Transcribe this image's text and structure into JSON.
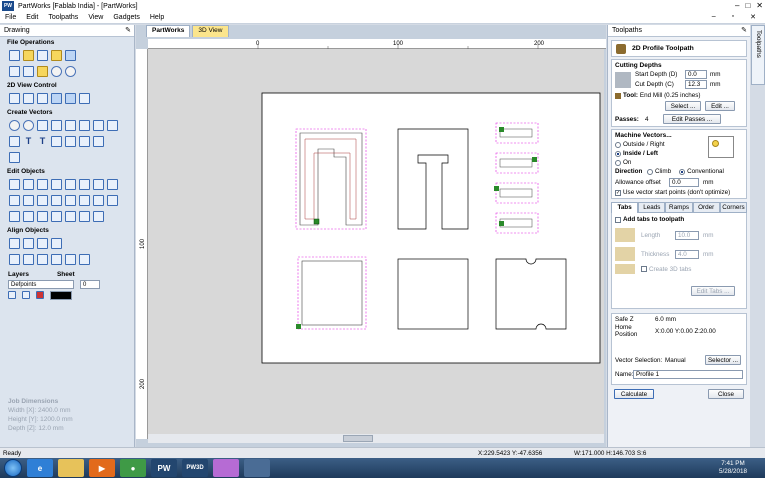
{
  "window": {
    "logo": "PW",
    "title": "PartWorks [Fablab India] - [PartWorks]",
    "controls": [
      "–",
      "□",
      "✕"
    ]
  },
  "menu": {
    "items": [
      "File",
      "Edit",
      "Toolpaths",
      "View",
      "Gadgets",
      "Help"
    ],
    "mdi_controls": [
      "–",
      "▫",
      "✕"
    ]
  },
  "drawing_panel": {
    "title": "Drawing",
    "sections": {
      "file_operations": "File Operations",
      "view_control": "2D View Control",
      "create_vectors": "Create Vectors",
      "edit_objects": "Edit Objects",
      "align_objects": "Align Objects"
    },
    "layers_label": "Layers",
    "sheet_label": "Sheet",
    "layer_value": "Defpoints",
    "sheet_value": "0",
    "job_dimensions": {
      "heading": "Job Dimensions",
      "width": "Width  [X]: 2400.0 mm",
      "height": "Height [Y]: 1200.0 mm",
      "depth": "Depth  [Z]: 12.0 mm"
    }
  },
  "view_tabs": {
    "tab1": "PartWorks",
    "tab2": "3D View"
  },
  "ruler": {
    "h_labels": [
      "0",
      "100",
      "200"
    ],
    "v_labels": [
      "100",
      "200"
    ]
  },
  "toolpaths_panel": {
    "title": "Toolpaths",
    "header": "2D Profile Toolpath",
    "cutting_depths": "Cutting Depths",
    "start_depth_label": "Start Depth (D)",
    "start_depth": "0.0",
    "cut_depth_label": "Cut Depth (C)",
    "cut_depth": "12.3",
    "unit": "mm",
    "tool_label": "Tool:",
    "tool_value": "End Mill (0.25 inches)",
    "select_btn": "Select ...",
    "edit_btn": "Edit ...",
    "passes_label": "Passes:",
    "passes_value": "4",
    "edit_passes_btn": "Edit Passes ...",
    "machine_vectors": "Machine Vectors...",
    "outside_right": "Outside / Right",
    "inside_left": "Inside / Left",
    "on": "On",
    "direction_label": "Direction",
    "climb": "Climb",
    "conventional": "Conventional",
    "allowance_label": "Allowance offset",
    "allowance_value": "0.0",
    "use_start_points": "Use vector start points (don't optimize)",
    "subtabs": [
      "Tabs",
      "Leads",
      "Ramps",
      "Order",
      "Corners"
    ],
    "add_tabs": "Add tabs to toolpath",
    "length_label": "Length",
    "length_value": "10.0",
    "thickness_label": "Thickness",
    "thickness_value": "4.0",
    "create_3d_tabs": "Create 3D tabs",
    "edit_tabs_btn": "Edit Tabs ...",
    "safe_z_label": "Safe Z",
    "safe_z_value": "6.0 mm",
    "home_label": "Home Position",
    "home_value": "X:0.00 Y:0.00 Z:20.00",
    "vector_selection_label": "Vector Selection:",
    "vector_selection_value": "Manual",
    "selector_btn": "Selector ...",
    "name_label": "Name:",
    "name_value": "Profile 1",
    "calculate_btn": "Calculate",
    "close_btn": "Close"
  },
  "side_tab": "Toolpaths",
  "status": {
    "ready": "Ready",
    "coords": "X:229.5423 Y:-47.6356",
    "dims": "W:171.000    H:146.703  S:6"
  },
  "taskbar": {
    "time": "7:41 PM",
    "date": "5/28/2018",
    "apps": [
      "IE",
      "Folder",
      "Media",
      "Chrome",
      "PW",
      "PW 3D",
      "Paint",
      "Tool"
    ]
  }
}
